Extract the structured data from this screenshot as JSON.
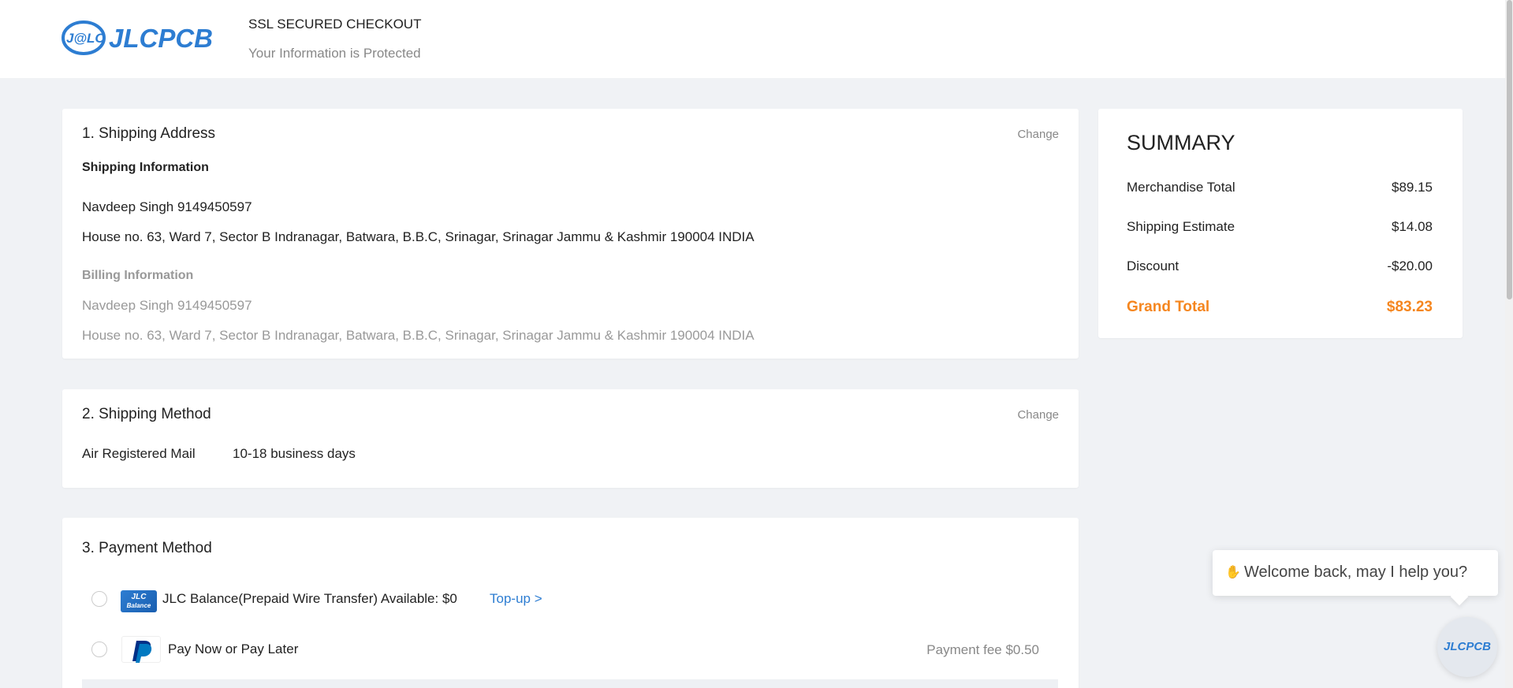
{
  "header": {
    "ssl_title": "SSL SECURED CHECKOUT",
    "ssl_subtitle": "Your Information is Protected",
    "logo_text": "J@LC JLCPCB"
  },
  "shipping_address": {
    "title": "1. Shipping Address",
    "change_label": "Change",
    "shipping_info_heading": "Shipping Information",
    "shipping_name": "Navdeep Singh 9149450597",
    "shipping_address": "House no. 63, Ward 7, Sector B Indranagar, Batwara, B.B.C, Srinagar, Srinagar Jammu & Kashmir 190004 INDIA",
    "billing_info_heading": "Billing Information",
    "billing_name": "Navdeep Singh 9149450597",
    "billing_address": "House no. 63, Ward 7, Sector B Indranagar, Batwara, B.B.C, Srinagar, Srinagar Jammu & Kashmir 190004 INDIA"
  },
  "shipping_method": {
    "title": "2. Shipping Method",
    "change_label": "Change",
    "method": "Air Registered Mail",
    "duration": "10-18 business days"
  },
  "payment_method": {
    "title": "3. Payment Method",
    "options": [
      {
        "label": "JLC Balance(Prepaid Wire Transfer) Available: $0",
        "action": "Top-up >",
        "badge": "JLC Balance",
        "selected": false
      },
      {
        "label": "Pay Now or Pay Later",
        "fee": "Payment fee $0.50",
        "icon": "paypal-icon",
        "selected": false
      }
    ]
  },
  "summary": {
    "title": "SUMMARY",
    "rows": [
      {
        "label": "Merchandise Total",
        "value": "$89.15"
      },
      {
        "label": "Shipping Estimate",
        "value": "$14.08"
      },
      {
        "label": "Discount",
        "value": "-$20.00"
      }
    ],
    "grand_total_label": "Grand Total",
    "grand_total_value": "$83.23"
  },
  "chat": {
    "message": "Welcome back, may I help you?",
    "avatar_text": "JLCPCB"
  },
  "colors": {
    "accent": "#f5861f",
    "link": "#2d7dd2",
    "background": "#f0f2f5"
  }
}
